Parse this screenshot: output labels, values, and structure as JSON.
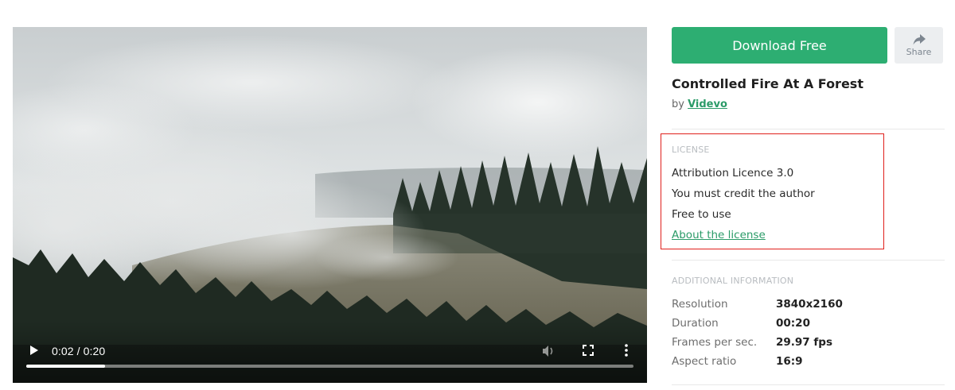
{
  "video": {
    "time": "0:02 / 0:20",
    "progress": 0.13,
    "icons": {
      "play": "play-icon",
      "volume": "volume-icon",
      "fullscreen": "fullscreen-icon",
      "more": "more-vertical-icon"
    }
  },
  "actions": {
    "download_label": "Download Free",
    "share_label": "Share",
    "share_icon": "share-arrow-icon"
  },
  "clip": {
    "title": "Controlled Fire At A Forest",
    "by_prefix": "by ",
    "author": "Videvo"
  },
  "license": {
    "heading": "LICENSE",
    "lines": [
      "Attribution Licence 3.0",
      "You must credit the author",
      "Free to use"
    ],
    "link": "About the license"
  },
  "info": {
    "heading": "ADDITIONAL INFORMATION",
    "rows": [
      {
        "key": "Resolution",
        "value": "3840x2160"
      },
      {
        "key": "Duration",
        "value": "00:20"
      },
      {
        "key": "Frames per sec.",
        "value": "29.97 fps"
      },
      {
        "key": "Aspect ratio",
        "value": "16:9"
      }
    ]
  },
  "colors": {
    "accent": "#2dae72",
    "link": "#2b9b68",
    "highlight_box": "#e0201c"
  }
}
